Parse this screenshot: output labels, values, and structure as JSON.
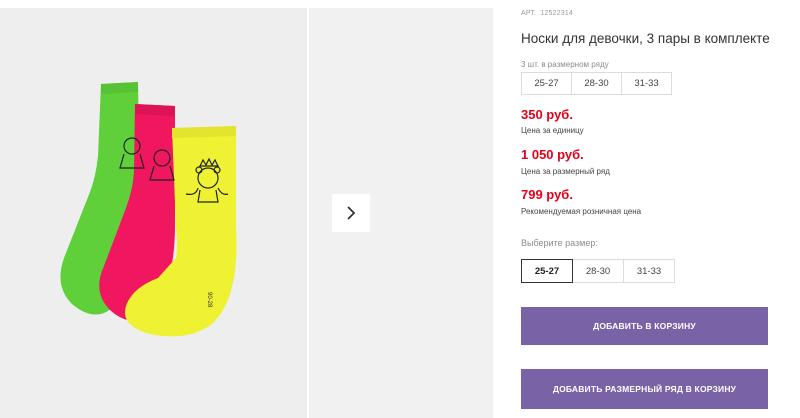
{
  "gallery": {
    "next_icon": "chevron-right-icon",
    "sock_colors": [
      "#5fd03a",
      "#f0165f",
      "#eff233"
    ],
    "sock_label": "90-28"
  },
  "product": {
    "art_label": "АРТ.",
    "art_number": "12522314",
    "title": "Носки для девочки, 3 пары в комплекте"
  },
  "pack": {
    "label": "3 шт. в размерном ряду",
    "sizes": [
      "25-27",
      "28-30",
      "31-33"
    ]
  },
  "prices": [
    {
      "value": "350 руб.",
      "note": "Цена за единицу"
    },
    {
      "value": "1 050 руб.",
      "note": "Цена за размерный ряд"
    },
    {
      "value": "799 руб.",
      "note": "Рекомендуемая розничная цена"
    }
  ],
  "size_select": {
    "label": "Выберите размер:",
    "sizes": [
      "25-27",
      "28-30",
      "31-33"
    ],
    "selected": "25-27"
  },
  "buttons": {
    "add_to_cart": "ДОБАВИТЬ В КОРЗИНУ",
    "add_range_to_cart": "ДОБАВИТЬ РАЗМЕРНЫЙ РЯД В КОРЗИНУ"
  },
  "colors": {
    "price": "#e2001a",
    "button": "#7a62a7"
  }
}
